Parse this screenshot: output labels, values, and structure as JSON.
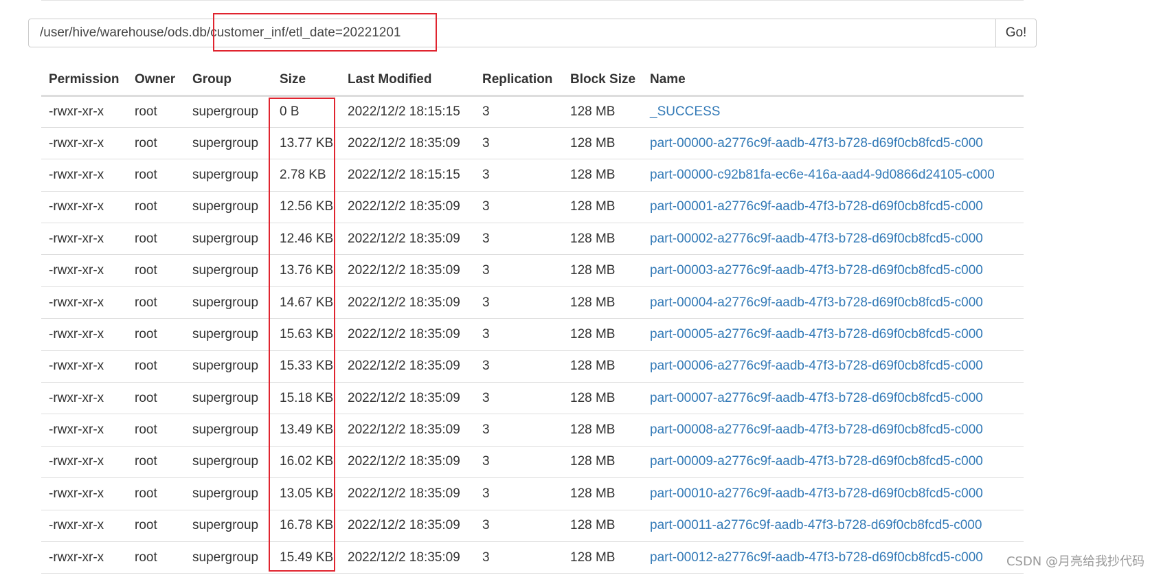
{
  "path_bar": {
    "value": "/user/hive/warehouse/ods.db/customer_inf/etl_date=20221201",
    "go_label": "Go!"
  },
  "table": {
    "headers": [
      "Permission",
      "Owner",
      "Group",
      "Size",
      "Last Modified",
      "Replication",
      "Block Size",
      "Name"
    ],
    "rows": [
      {
        "permission": "-rwxr-xr-x",
        "owner": "root",
        "group": "supergroup",
        "size": "0 B",
        "modified": "2022/12/2 18:15:15",
        "replication": "3",
        "block_size": "128 MB",
        "name": "_SUCCESS"
      },
      {
        "permission": "-rwxr-xr-x",
        "owner": "root",
        "group": "supergroup",
        "size": "13.77 KB",
        "modified": "2022/12/2 18:35:09",
        "replication": "3",
        "block_size": "128 MB",
        "name": "part-00000-a2776c9f-aadb-47f3-b728-d69f0cb8fcd5-c000"
      },
      {
        "permission": "-rwxr-xr-x",
        "owner": "root",
        "group": "supergroup",
        "size": "2.78 KB",
        "modified": "2022/12/2 18:15:15",
        "replication": "3",
        "block_size": "128 MB",
        "name": "part-00000-c92b81fa-ec6e-416a-aad4-9d0866d24105-c000"
      },
      {
        "permission": "-rwxr-xr-x",
        "owner": "root",
        "group": "supergroup",
        "size": "12.56 KB",
        "modified": "2022/12/2 18:35:09",
        "replication": "3",
        "block_size": "128 MB",
        "name": "part-00001-a2776c9f-aadb-47f3-b728-d69f0cb8fcd5-c000"
      },
      {
        "permission": "-rwxr-xr-x",
        "owner": "root",
        "group": "supergroup",
        "size": "12.46 KB",
        "modified": "2022/12/2 18:35:09",
        "replication": "3",
        "block_size": "128 MB",
        "name": "part-00002-a2776c9f-aadb-47f3-b728-d69f0cb8fcd5-c000"
      },
      {
        "permission": "-rwxr-xr-x",
        "owner": "root",
        "group": "supergroup",
        "size": "13.76 KB",
        "modified": "2022/12/2 18:35:09",
        "replication": "3",
        "block_size": "128 MB",
        "name": "part-00003-a2776c9f-aadb-47f3-b728-d69f0cb8fcd5-c000"
      },
      {
        "permission": "-rwxr-xr-x",
        "owner": "root",
        "group": "supergroup",
        "size": "14.67 KB",
        "modified": "2022/12/2 18:35:09",
        "replication": "3",
        "block_size": "128 MB",
        "name": "part-00004-a2776c9f-aadb-47f3-b728-d69f0cb8fcd5-c000"
      },
      {
        "permission": "-rwxr-xr-x",
        "owner": "root",
        "group": "supergroup",
        "size": "15.63 KB",
        "modified": "2022/12/2 18:35:09",
        "replication": "3",
        "block_size": "128 MB",
        "name": "part-00005-a2776c9f-aadb-47f3-b728-d69f0cb8fcd5-c000"
      },
      {
        "permission": "-rwxr-xr-x",
        "owner": "root",
        "group": "supergroup",
        "size": "15.33 KB",
        "modified": "2022/12/2 18:35:09",
        "replication": "3",
        "block_size": "128 MB",
        "name": "part-00006-a2776c9f-aadb-47f3-b728-d69f0cb8fcd5-c000"
      },
      {
        "permission": "-rwxr-xr-x",
        "owner": "root",
        "group": "supergroup",
        "size": "15.18 KB",
        "modified": "2022/12/2 18:35:09",
        "replication": "3",
        "block_size": "128 MB",
        "name": "part-00007-a2776c9f-aadb-47f3-b728-d69f0cb8fcd5-c000"
      },
      {
        "permission": "-rwxr-xr-x",
        "owner": "root",
        "group": "supergroup",
        "size": "13.49 KB",
        "modified": "2022/12/2 18:35:09",
        "replication": "3",
        "block_size": "128 MB",
        "name": "part-00008-a2776c9f-aadb-47f3-b728-d69f0cb8fcd5-c000"
      },
      {
        "permission": "-rwxr-xr-x",
        "owner": "root",
        "group": "supergroup",
        "size": "16.02 KB",
        "modified": "2022/12/2 18:35:09",
        "replication": "3",
        "block_size": "128 MB",
        "name": "part-00009-a2776c9f-aadb-47f3-b728-d69f0cb8fcd5-c000"
      },
      {
        "permission": "-rwxr-xr-x",
        "owner": "root",
        "group": "supergroup",
        "size": "13.05 KB",
        "modified": "2022/12/2 18:35:09",
        "replication": "3",
        "block_size": "128 MB",
        "name": "part-00010-a2776c9f-aadb-47f3-b728-d69f0cb8fcd5-c000"
      },
      {
        "permission": "-rwxr-xr-x",
        "owner": "root",
        "group": "supergroup",
        "size": "16.78 KB",
        "modified": "2022/12/2 18:35:09",
        "replication": "3",
        "block_size": "128 MB",
        "name": "part-00011-a2776c9f-aadb-47f3-b728-d69f0cb8fcd5-c000"
      },
      {
        "permission": "-rwxr-xr-x",
        "owner": "root",
        "group": "supergroup",
        "size": "15.49 KB",
        "modified": "2022/12/2 18:35:09",
        "replication": "3",
        "block_size": "128 MB",
        "name": "part-00012-a2776c9f-aadb-47f3-b728-d69f0cb8fcd5-c000"
      }
    ]
  },
  "watermark": "CSDN @月亮给我抄代码",
  "colors": {
    "link": "#337ab7",
    "highlight": "#e0242f",
    "border": "#dddddd"
  }
}
